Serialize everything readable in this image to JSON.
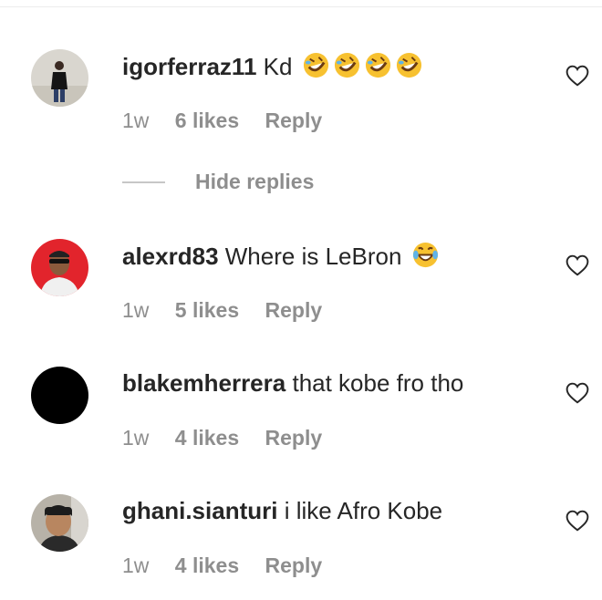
{
  "comments": [
    {
      "username": "igorferraz11",
      "text": "Kd",
      "emoji": [
        "rofl-emoji",
        "rofl-emoji",
        "rofl-emoji",
        "rofl-emoji"
      ],
      "time": "1w",
      "likes": "6 likes",
      "reply": "Reply"
    },
    {
      "username": "alexrd83",
      "text": "Where is LeBron",
      "emoji": [
        "joy-emoji"
      ],
      "time": "1w",
      "likes": "5 likes",
      "reply": "Reply"
    },
    {
      "username": "blakemherrera",
      "text": "that kobe fro tho",
      "time": "1w",
      "likes": "4 likes",
      "reply": "Reply"
    },
    {
      "username": "ghani.sianturi",
      "text": "i like Afro Kobe",
      "time": "1w",
      "likes": "4 likes",
      "reply": "Reply"
    }
  ],
  "replies_toggle": {
    "label": "Hide replies"
  },
  "icons": {
    "like": "heart-outline-icon"
  },
  "colors": {
    "text": "#262626",
    "secondary": "#8e8e8e",
    "emoji": "#f7c130"
  }
}
